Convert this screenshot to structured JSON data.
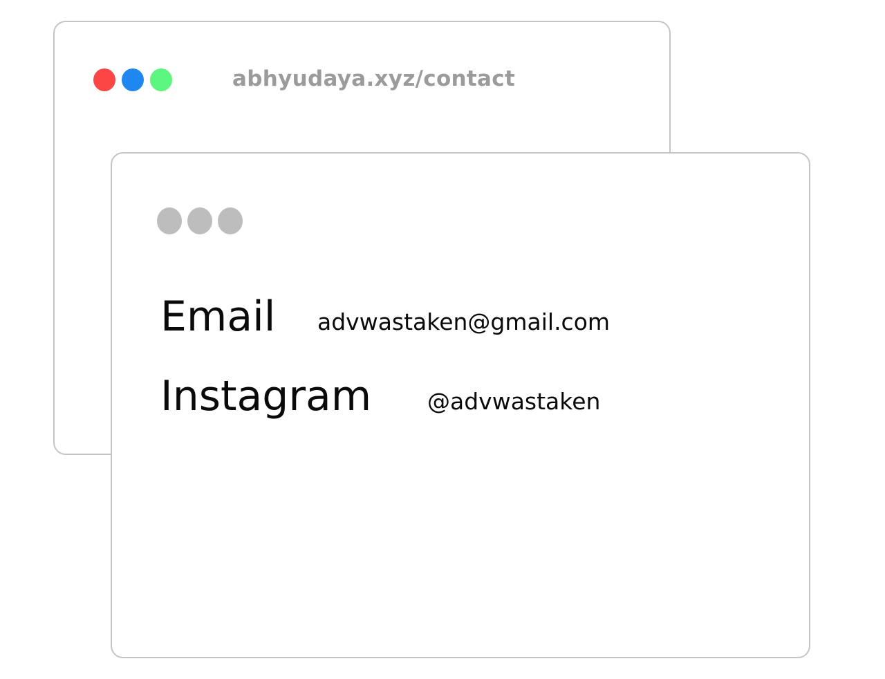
{
  "back_window": {
    "url": "abhyudaya.xyz/contact",
    "dots": [
      {
        "name": "close-dot",
        "color": "#fc4646"
      },
      {
        "name": "minimize-dot",
        "color": "#1e87f0"
      },
      {
        "name": "maximize-dot",
        "color": "#5cf57f"
      }
    ]
  },
  "front_window": {
    "dot_color": "#bdbdbd",
    "contacts": [
      {
        "label": "Email",
        "value": "advwastaken@gmail.com"
      },
      {
        "label": "Instagram",
        "value": "@advwastaken"
      }
    ]
  }
}
